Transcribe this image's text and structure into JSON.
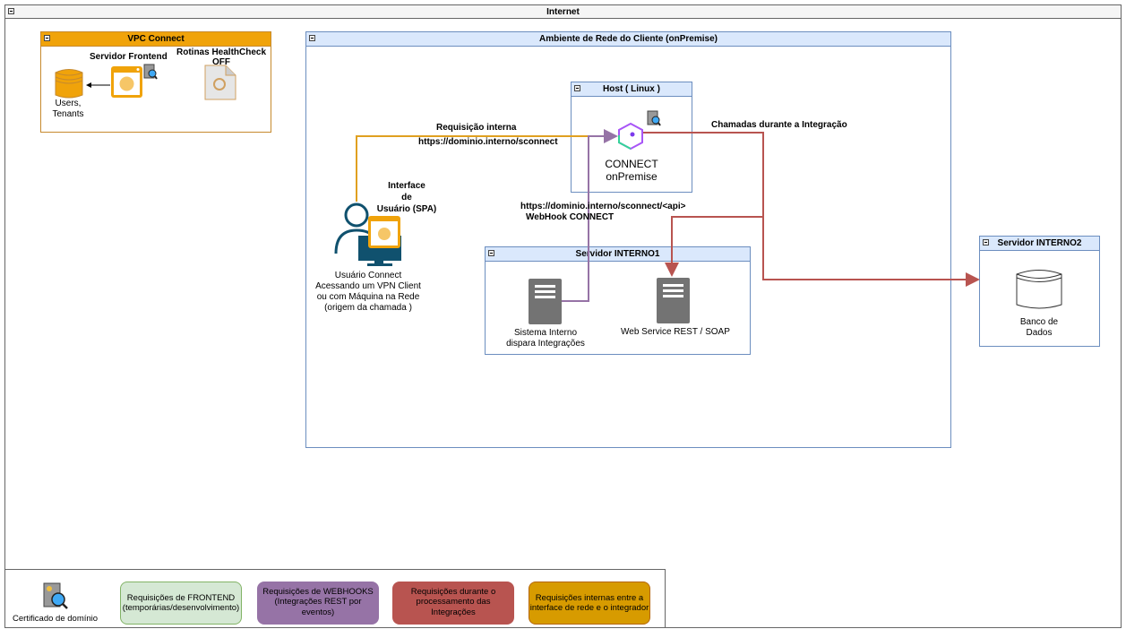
{
  "containers": {
    "internet": "Internet",
    "vpc": "VPC Connect",
    "ambiente": "Ambiente de Rede do Cliente (onPremise)",
    "host": "Host ( Linux )",
    "interno1": "Servidor INTERNO1",
    "interno2": "Servidor INTERNO2"
  },
  "vpc": {
    "frontend_label": "Servidor Frontend",
    "healthcheck_label_1": "Rotinas HealthCheck",
    "healthcheck_label_2": "OFF",
    "users_label_1": "Users,",
    "users_label_2": "Tenants"
  },
  "main": {
    "req_interna": "Requisição interna",
    "req_url": "https://dominio.interno/sconnect",
    "interface_1": "Interface",
    "interface_2": "de",
    "interface_3": "Usuário (SPA)",
    "user_1": "Usuário Connect",
    "user_2": "Acessando um VPN Client",
    "user_3": "ou com Máquina na Rede",
    "user_4": "(origem da chamada )",
    "connect_1": "CONNECT",
    "connect_2": "onPremise",
    "chamadas": "Chamadas durante a Integração",
    "webhook_url": "https://dominio.interno/sconnect/<api>",
    "webhook_label": "WebHook CONNECT",
    "sistema_1": "Sistema Interno",
    "sistema_2": "dispara Integrações",
    "webservice": "Web Service REST / SOAP",
    "banco_1": "Banco de",
    "banco_2": "Dados"
  },
  "legend": {
    "certificado": "Certificado de domínio",
    "frontend": [
      "Requisições de FRONTEND",
      "(temporárias/desenvolvimento)"
    ],
    "webhooks": [
      "Requisições de WEBHOOKS",
      "(Integrações REST por",
      "eventos)"
    ],
    "durante": [
      "Requisições durante o",
      "processamento das",
      "Integrações"
    ],
    "internas": [
      "Requisições internas entre a",
      "interface de rede e o integrador"
    ]
  },
  "colors": {
    "orange": "#f0a30a",
    "purple": "#9673a6",
    "red": "#b85450",
    "blue_header": "#dae8fc",
    "green": "#d5e8d4"
  }
}
